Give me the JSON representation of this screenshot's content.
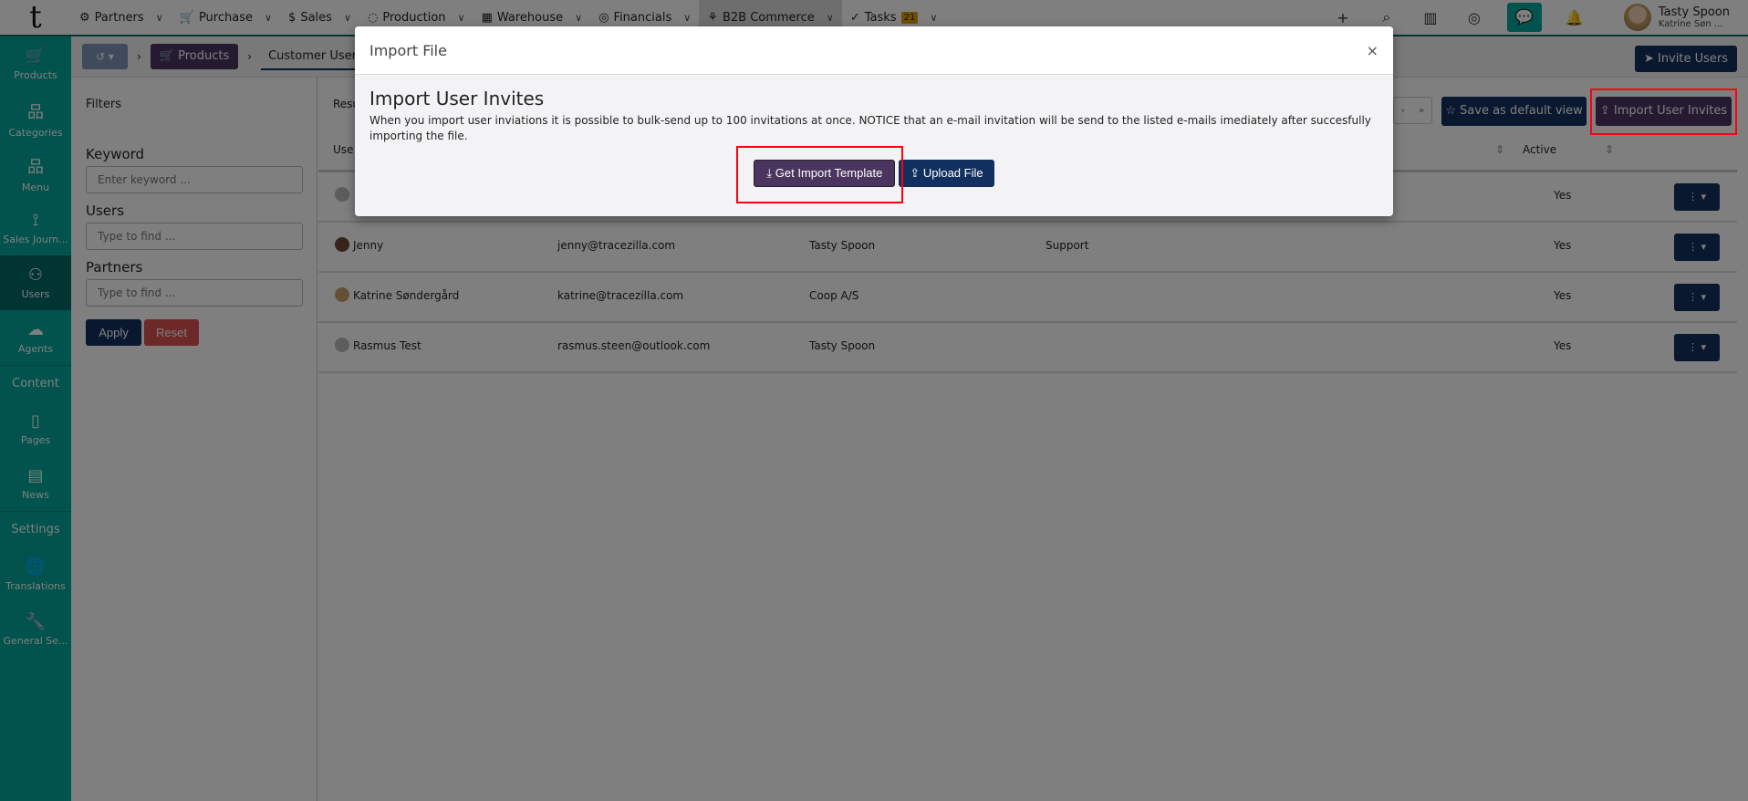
{
  "topnav": {
    "logo": "t",
    "items": [
      {
        "label": "Partners",
        "icon": "handshake-icon"
      },
      {
        "label": "Purchase",
        "icon": "cart-icon"
      },
      {
        "label": "Sales",
        "icon": "money-hand-icon"
      },
      {
        "label": "Production",
        "icon": "apple-icon"
      },
      {
        "label": "Warehouse",
        "icon": "warehouse-icon"
      },
      {
        "label": "Financials",
        "icon": "coins-icon"
      },
      {
        "label": "B2B Commerce",
        "icon": "b2b-icon",
        "active": true
      },
      {
        "label": "Tasks",
        "icon": "check-icon",
        "badge": "21"
      }
    ],
    "user": {
      "name": "Tasty Spoon",
      "sub": "Katrine Søn ..."
    }
  },
  "sidebar": {
    "items": [
      {
        "label": "Products"
      },
      {
        "label": "Categories"
      },
      {
        "label": "Menu"
      },
      {
        "label": "Sales Journ..."
      },
      {
        "label": "Users",
        "active": true
      },
      {
        "label": "Agents"
      }
    ],
    "content_heading": "Content",
    "content_items": [
      {
        "label": "Pages"
      },
      {
        "label": "News"
      }
    ],
    "settings_heading": "Settings",
    "settings_items": [
      {
        "label": "Translations"
      },
      {
        "label": "General Se..."
      }
    ]
  },
  "breadcrumb": {
    "parent": "Products",
    "current": "Customer Users",
    "invite_label": "Invite Users"
  },
  "filters": {
    "title": "Filters",
    "keyword_label": "Keyword",
    "keyword_placeholder": "Enter keyword ...",
    "users_label": "Users",
    "users_placeholder": "Type to find ...",
    "partners_label": "Partners",
    "partners_placeholder": "Type to find ...",
    "apply": "Apply",
    "reset": "Reset"
  },
  "main": {
    "results_label": "Resu",
    "pager_next": "›",
    "pager_last": "»",
    "save_default": "Save as default view",
    "import_invites": "Import User Invites",
    "columns": {
      "user": "Use",
      "active": "Active"
    },
    "rows": [
      {
        "name": "",
        "email": "",
        "partner": "",
        "role": "",
        "active": "Yes"
      },
      {
        "name": "Jenny",
        "email": "jenny@tracezilla.com",
        "partner": "Tasty Spoon",
        "role": "Support",
        "active": "Yes"
      },
      {
        "name": "Katrine Søndergård",
        "email": "katrine@tracezilla.com",
        "partner": "Coop A/S",
        "role": "",
        "active": "Yes"
      },
      {
        "name": "Rasmus Test",
        "email": "rasmus.steen@outlook.com",
        "partner": "Tasty Spoon",
        "role": "",
        "active": "Yes"
      }
    ]
  },
  "modal": {
    "title": "Import File",
    "close": "×",
    "heading": "Import User Invites",
    "text": "When you import user inviations it is possible to bulk-send up to 100 invitations at once. NOTICE that an e-mail invitation will be send to the listed e-mails imediately after succesfully importing the file.",
    "get_template": "Get Import Template",
    "upload": "Upload File"
  },
  "colors": {
    "teal": "#04a49a",
    "navy": "#12305f",
    "purple": "#4a3560",
    "highlight": "#ff0010"
  }
}
